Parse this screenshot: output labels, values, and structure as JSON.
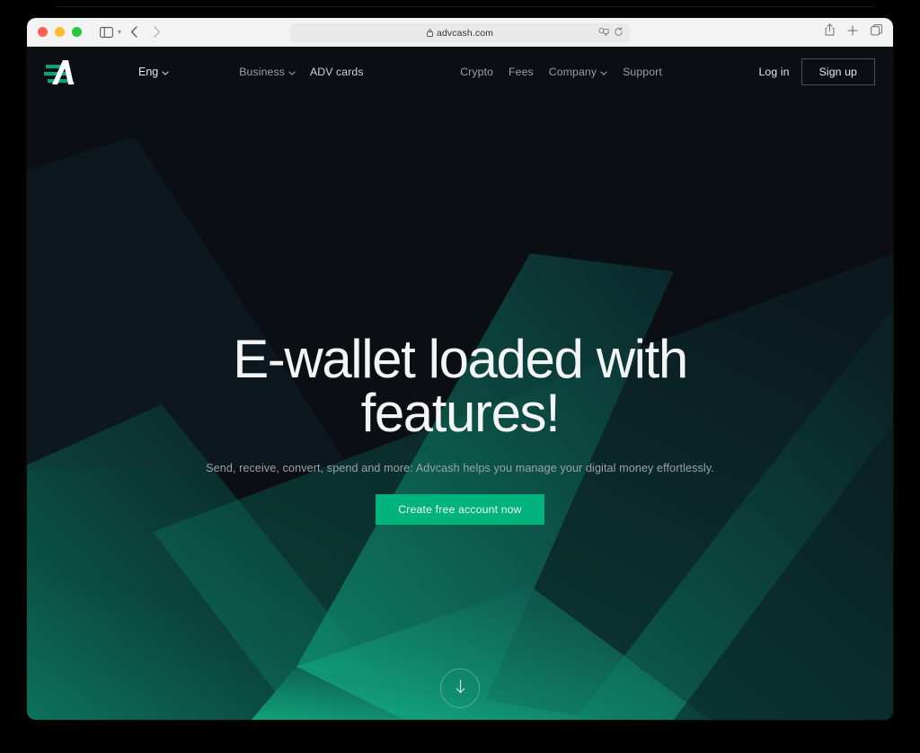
{
  "browser": {
    "url": "advcash.com",
    "lock_icon": "lock-icon",
    "traffic_lights": [
      "close",
      "minimize",
      "maximize"
    ],
    "sidebar_icon": "sidebar-toggle-icon",
    "back_icon": "back-arrow-icon",
    "forward_icon": "forward-arrow-icon",
    "shield_icon": "privacy-shield-icon",
    "extensions_icon": "extensions-icon",
    "reload_icon": "reload-icon",
    "share_icon": "share-icon",
    "newtab_icon": "plus-icon",
    "tabs_icon": "tab-overview-icon"
  },
  "site": {
    "logo_name": "advcash-logo",
    "language": {
      "label": "Eng",
      "chevron": "chevron-down-icon"
    },
    "nav_primary": [
      {
        "label": "Business",
        "chevron": true
      },
      {
        "label": "ADV cards",
        "chevron": false
      }
    ],
    "nav_secondary": [
      {
        "label": "Crypto",
        "chevron": false
      },
      {
        "label": "Fees",
        "chevron": false
      },
      {
        "label": "Company",
        "chevron": true
      },
      {
        "label": "Support",
        "chevron": false
      }
    ],
    "auth": {
      "login_label": "Log in",
      "signup_label": "Sign up"
    }
  },
  "hero": {
    "headline": "E-wallet loaded with features!",
    "subtitle": "Send, receive, convert, spend and more: Advcash helps you manage your digital money effortlessly.",
    "cta_label": "Create free account now",
    "scroll_icon": "arrow-down-icon"
  },
  "colors": {
    "accent_green": "#00b27c",
    "page_background": "#0b0f14",
    "bright_green": "#10a078",
    "toolbar_background": "#f3f3f3",
    "headline_text": "#f2f4f5",
    "muted_text": "#9aa0a4"
  }
}
